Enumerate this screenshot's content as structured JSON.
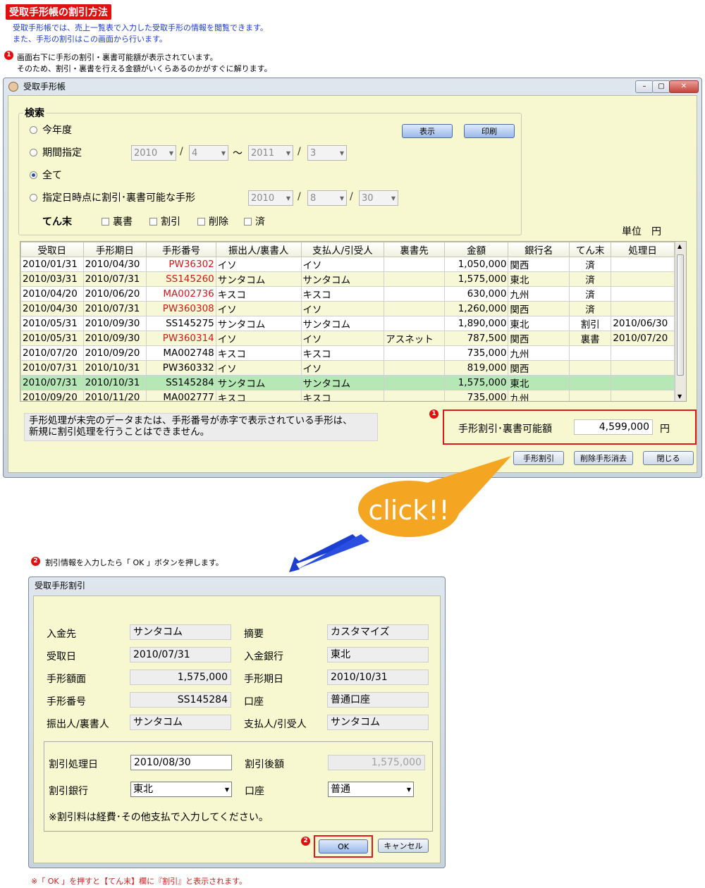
{
  "header": {
    "title": "受取手形帳の割引方法",
    "intro1": "受取手形帳では、売上一覧表で入力した受取手形の情報を閲覧できます。",
    "intro2": "また、手形の割引はこの画面から行います。",
    "note1_num": "1",
    "note1_line1": "画面右下に手形の割引・裏書可能額が表示されています。",
    "note1_line2": "そのため、割引・裏書を行える金額がいくらあるのかがすぐに解ります。"
  },
  "main_window": {
    "title": "受取手形帳",
    "search": {
      "heading": "検索",
      "radio_this_year": "今年度",
      "radio_period": "期間指定",
      "radio_all": "全て",
      "radio_date": "指定日時点に割引･裏書可能な手形",
      "period_from_year": "2010",
      "period_from_month": "4",
      "tilde": "～",
      "period_to_year": "2011",
      "period_to_month": "3",
      "date_year": "2010",
      "date_month": "8",
      "date_day": "30",
      "slash": "/",
      "tenmatsu_label": "てん末",
      "chk_uragaki": "裏書",
      "chk_waribiki": "割引",
      "chk_sakujo": "削除",
      "chk_zumi": "済",
      "btn_show": "表示",
      "btn_print": "印刷"
    },
    "unit_label": "単位　円",
    "table": {
      "headers": [
        "受取日",
        "手形期日",
        "手形番号",
        "振出人/裏書人",
        "支払人/引受人",
        "裏書先",
        "金額",
        "銀行名",
        "てん末",
        "処理日"
      ],
      "rows": [
        [
          "2010/01/31",
          "2010/04/30",
          "PW36302",
          "イソ",
          "イソ",
          "",
          "1,050,000",
          "関西",
          "済",
          ""
        ],
        [
          "2010/03/31",
          "2010/07/31",
          "SS145260",
          "サンタコム",
          "サンタコム",
          "",
          "1,575,000",
          "東北",
          "済",
          ""
        ],
        [
          "2010/04/20",
          "2010/06/20",
          "MA002736",
          "キスコ",
          "キスコ",
          "",
          "630,000",
          "九州",
          "済",
          ""
        ],
        [
          "2010/04/30",
          "2010/07/31",
          "PW360308",
          "イソ",
          "イソ",
          "",
          "1,260,000",
          "関西",
          "済",
          ""
        ],
        [
          "2010/05/31",
          "2010/09/30",
          "SS145275",
          "サンタコム",
          "サンタコム",
          "",
          "1,890,000",
          "東北",
          "割引",
          "2010/06/30"
        ],
        [
          "2010/05/31",
          "2010/09/30",
          "PW360314",
          "イソ",
          "イソ",
          "アスネット",
          "787,500",
          "関西",
          "裏書",
          "2010/07/20"
        ],
        [
          "2010/07/20",
          "2010/09/20",
          "MA002748",
          "キスコ",
          "キスコ",
          "",
          "735,000",
          "九州",
          "",
          ""
        ],
        [
          "2010/07/31",
          "2010/10/31",
          "PW360332",
          "イソ",
          "イソ",
          "",
          "819,000",
          "関西",
          "",
          ""
        ],
        [
          "2010/07/31",
          "2010/10/31",
          "SS145284",
          "サンタコム",
          "サンタコム",
          "",
          "1,575,000",
          "東北",
          "",
          ""
        ],
        [
          "2010/09/20",
          "2010/11/20",
          "MA002777",
          "キスコ",
          "キスコ",
          "",
          "735,000",
          "九州",
          "",
          ""
        ]
      ],
      "red_rows": [
        0,
        1,
        2,
        3,
        5
      ],
      "selected_row": 8
    },
    "info_line1": "手形処理が未完のデータまたは、手形番号が赤字で表示されている手形は、",
    "info_line2": "新規に割引処理を行うことはできません。",
    "available_num": "1",
    "available_label": "手形割引･裏書可能額",
    "available_value": "4,599,000",
    "available_unit": "円",
    "btn_discount": "手形割引",
    "btn_delete_past": "削除手形消去",
    "btn_close": "閉じる"
  },
  "callout": {
    "text": "click!!"
  },
  "note2": {
    "num": "2",
    "text": "割引情報を入力したら「 OK 」ボタンを押します。"
  },
  "dialog": {
    "title": "受取手形割引",
    "fields": {
      "nyukin_saki_label": "入金先",
      "nyukin_saki": "サンタコム",
      "tekiyo_label": "摘要",
      "tekiyo": "カスタマイズ",
      "uketori_bi_label": "受取日",
      "uketori_bi": "2010/07/31",
      "nyukin_ginko_label": "入金銀行",
      "nyukin_ginko": "東北",
      "gakumen_label": "手形額面",
      "gakumen": "1,575,000",
      "kijitsu_label": "手形期日",
      "kijitsu": "2010/10/31",
      "bango_label": "手形番号",
      "bango": "SS145284",
      "koza_label": "口座",
      "koza": "普通口座",
      "furidashi_label": "振出人/裏書人",
      "furidashi": "サンタコム",
      "shiharai_label": "支払人/引受人",
      "shiharai": "サンタコム"
    },
    "discount": {
      "date_label": "割引処理日",
      "date": "2010/08/30",
      "after_label": "割引後額",
      "after": "1,575,000",
      "bank_label": "割引銀行",
      "bank": "東北",
      "account_label": "口座",
      "account": "普通",
      "note": "※割引料は経費･その他支払で入力してください。"
    },
    "ok_num": "2",
    "btn_ok": "OK",
    "btn_cancel": "キャンセル"
  },
  "footer_note": "※「 OK 」を押すと【てん末】欄に『割引』と表示されます。"
}
